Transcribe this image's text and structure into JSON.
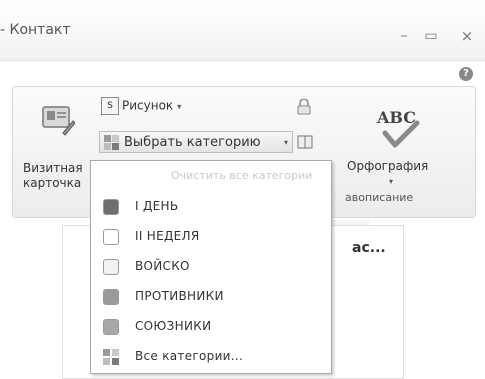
{
  "window": {
    "title": "- Контакт",
    "minimize": "–",
    "maximize": "▭",
    "close": "×",
    "help": "?"
  },
  "ribbon": {
    "vcard_label_line1": "Визитная",
    "vcard_label_line2": "карточка",
    "picture_label": "Рисунок",
    "picture_arrow": "▾",
    "category_label": "Выбрать категорию",
    "category_arrow": "▾",
    "spelling_label": "Орфография",
    "spelling_arrow": "▾",
    "group_label": "авописание"
  },
  "body": {
    "text": "ас..."
  },
  "menu": {
    "clear_label": "Очистить все категории",
    "items": [
      {
        "label": "I ДЕНЬ",
        "color": "#6e6e6e"
      },
      {
        "label": "II НЕДЕЛЯ",
        "color": "#ffffff"
      },
      {
        "label": "ВОЙСКО",
        "color": "#f2f2f2"
      },
      {
        "label": "ПРОТИВНИКИ",
        "color": "#9a9a9a"
      },
      {
        "label": "СОЮЗНИКИ",
        "color": "#a8a8a8"
      }
    ],
    "all_categories": "Все категории..."
  }
}
